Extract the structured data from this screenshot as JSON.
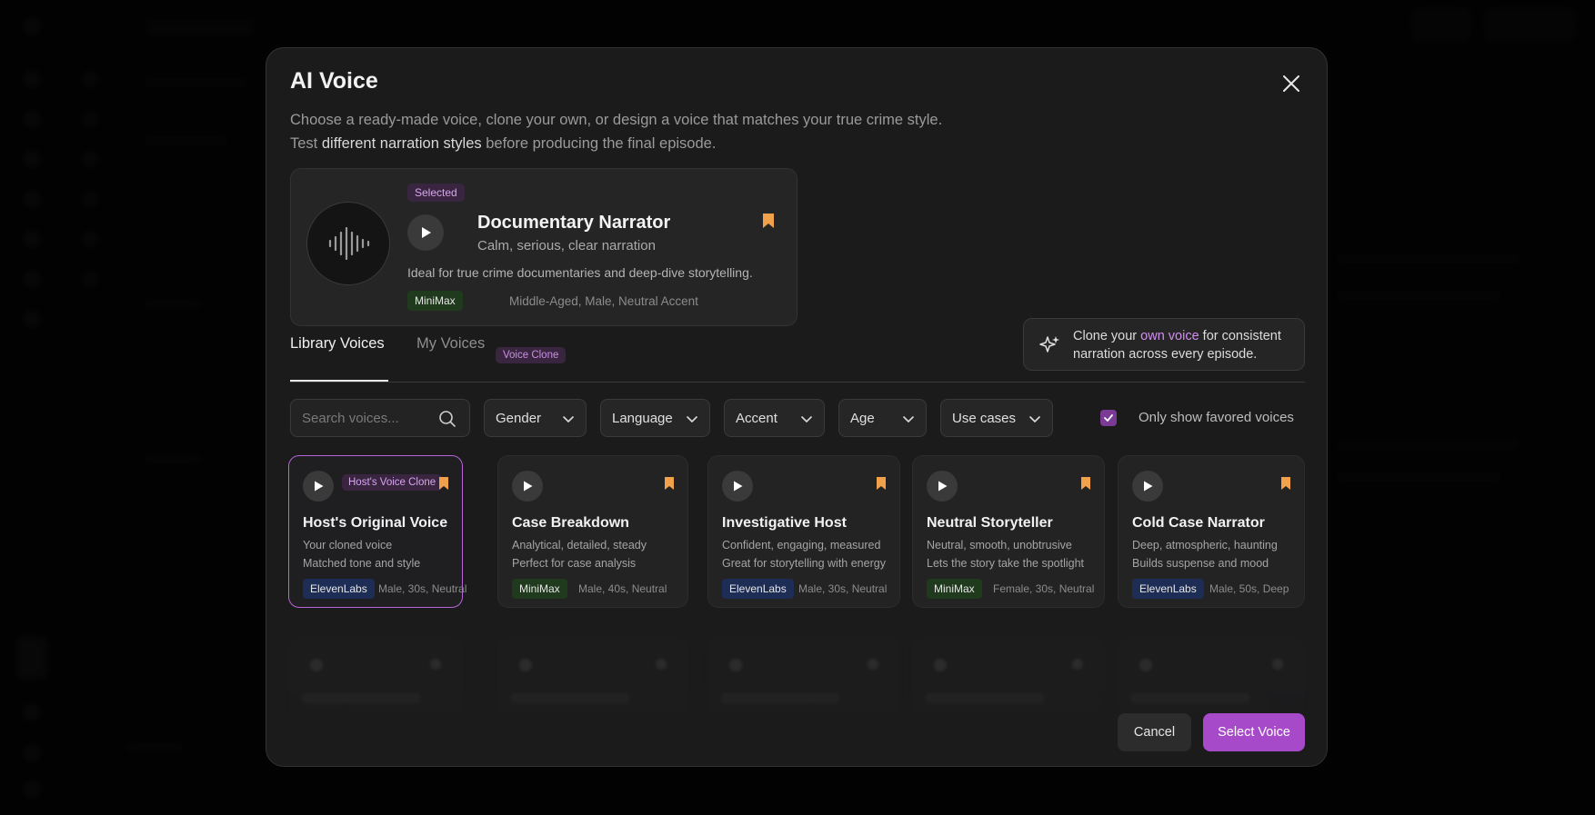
{
  "modal": {
    "title": "AI Voice",
    "subtitle_line1": "Choose a ready-made voice, clone your own, or design a voice that matches your true crime style.",
    "subtitle_line2_pre": "Test ",
    "subtitle_line2_b1": "different narration",
    "subtitle_line2_mid": " styles",
    "subtitle_line2_post": " before producing the final episode."
  },
  "selected_voice": {
    "badge": "Selected",
    "name": "Documentary Narrator",
    "description": "Calm, serious, clear narration",
    "ideal": "Ideal for true crime documentaries and deep-dive storytelling.",
    "provider": "MiniMax",
    "meta": "Middle-Aged, Male, Neutral Accent"
  },
  "clone_callout": {
    "pre": "Clone your ",
    "accent": "own voice",
    "post": " for consistent",
    "line2": "narration across every episode."
  },
  "tabs": {
    "library": "Library Voices",
    "my": "My Voices",
    "my_badge": "Voice Clone"
  },
  "filters": {
    "search_placeholder": "Search voices...",
    "gender": "Gender",
    "language": "Language",
    "accent": "Accent",
    "age": "Age",
    "use_cases": "Use cases",
    "favorites_label": "Only show favored voices",
    "favorites_checked": true
  },
  "voices": [
    {
      "name": "Host's Original Voice",
      "tag": "Host's Voice Clone",
      "line1": "Your cloned voice",
      "line2": "Matched tone and style",
      "provider": "ElevenLabs",
      "meta": "Male, 30s, Neutral",
      "selected": true
    },
    {
      "name": "Case Breakdown",
      "line1": "Analytical, detailed, steady",
      "line2": "Perfect for case analysis",
      "provider": "MiniMax",
      "meta": "Male, 40s, Neutral"
    },
    {
      "name": "Investigative Host",
      "line1": "Confident, engaging, measured",
      "line2": "Great for storytelling with energy",
      "provider": "ElevenLabs",
      "meta": "Male, 30s, Neutral"
    },
    {
      "name": "Neutral Storyteller",
      "line1": "Neutral, smooth, unobtrusive",
      "line2": "Lets the story take the spotlight",
      "provider": "MiniMax",
      "meta": "Female, 30s, Neutral"
    },
    {
      "name": "Cold Case Narrator",
      "line1": "Deep, atmospheric, haunting",
      "line2": "Builds suspense and mood",
      "provider": "ElevenLabs",
      "meta": "Male, 50s, Deep"
    }
  ],
  "actions": {
    "cancel": "Cancel",
    "select": "Select Voice"
  },
  "colors": {
    "accent": "#a74ac9",
    "bookmark": "#f0a14a",
    "minimax_badge": "#1f3a1c",
    "elevenlabs_badge": "#1e2d55"
  }
}
